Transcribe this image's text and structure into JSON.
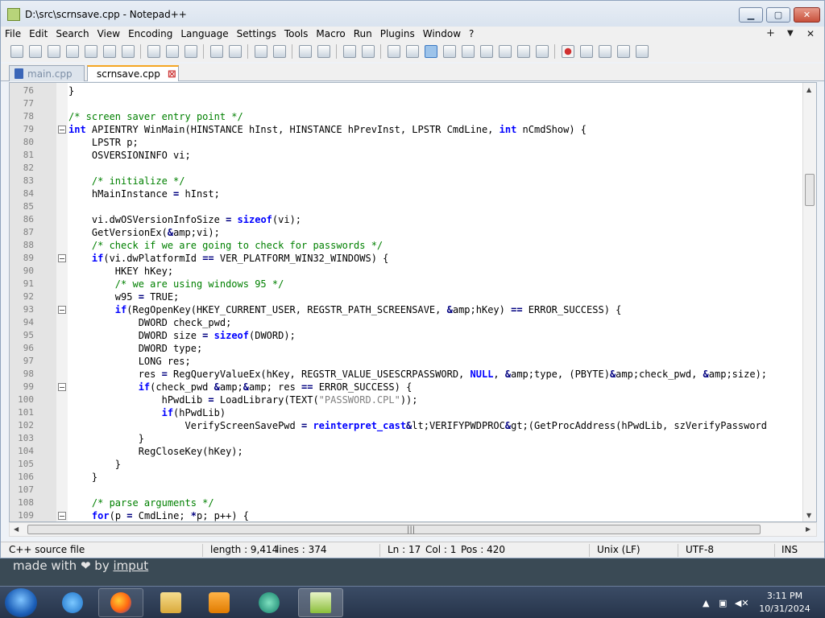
{
  "window": {
    "title": "D:\\src\\scrnsave.cpp - Notepad++"
  },
  "menu": [
    "File",
    "Edit",
    "Search",
    "View",
    "Encoding",
    "Language",
    "Settings",
    "Tools",
    "Macro",
    "Run",
    "Plugins",
    "Window",
    "?"
  ],
  "menu_right": {
    "plus": "+",
    "dropdown": "▼",
    "close": "✕"
  },
  "tabs": [
    {
      "label": "main.cpp",
      "active": false
    },
    {
      "label": "scrnsave.cpp",
      "active": true
    }
  ],
  "code_lines": [
    {
      "n": "76",
      "text": "}",
      "fold": false
    },
    {
      "n": "77",
      "text": "",
      "fold": false
    },
    {
      "n": "78",
      "text": "/* screen saver entry point */",
      "fold": false
    },
    {
      "n": "79",
      "text": "int APIENTRY WinMain(HINSTANCE hInst, HINSTANCE hPrevInst, LPSTR CmdLine, int nCmdShow) {",
      "fold": true
    },
    {
      "n": "80",
      "text": "    LPSTR p;",
      "fold": false
    },
    {
      "n": "81",
      "text": "    OSVERSIONINFO vi;",
      "fold": false
    },
    {
      "n": "82",
      "text": "",
      "fold": false
    },
    {
      "n": "83",
      "text": "    /* initialize */",
      "fold": false
    },
    {
      "n": "84",
      "text": "    hMainInstance = hInst;",
      "fold": false
    },
    {
      "n": "85",
      "text": "",
      "fold": false
    },
    {
      "n": "86",
      "text": "    vi.dwOSVersionInfoSize = sizeof(vi);",
      "fold": false
    },
    {
      "n": "87",
      "text": "    GetVersionEx(&vi);",
      "fold": false
    },
    {
      "n": "88",
      "text": "    /* check if we are going to check for passwords */",
      "fold": false
    },
    {
      "n": "89",
      "text": "    if(vi.dwPlatformId == VER_PLATFORM_WIN32_WINDOWS) {",
      "fold": true
    },
    {
      "n": "90",
      "text": "        HKEY hKey;",
      "fold": false
    },
    {
      "n": "91",
      "text": "        /* we are using windows 95 */",
      "fold": false
    },
    {
      "n": "92",
      "text": "        w95 = TRUE;",
      "fold": false
    },
    {
      "n": "93",
      "text": "        if(RegOpenKey(HKEY_CURRENT_USER, REGSTR_PATH_SCREENSAVE, &hKey) == ERROR_SUCCESS) {",
      "fold": true
    },
    {
      "n": "94",
      "text": "            DWORD check_pwd;",
      "fold": false
    },
    {
      "n": "95",
      "text": "            DWORD size = sizeof(DWORD);",
      "fold": false
    },
    {
      "n": "96",
      "text": "            DWORD type;",
      "fold": false
    },
    {
      "n": "97",
      "text": "            LONG res;",
      "fold": false
    },
    {
      "n": "98",
      "text": "            res = RegQueryValueEx(hKey, REGSTR_VALUE_USESCRPASSWORD, NULL, &type, (PBYTE)&check_pwd, &size);",
      "fold": false
    },
    {
      "n": "99",
      "text": "            if(check_pwd && res == ERROR_SUCCESS) {",
      "fold": true
    },
    {
      "n": "100",
      "text": "                hPwdLib = LoadLibrary(TEXT(\"PASSWORD.CPL\"));",
      "fold": false
    },
    {
      "n": "101",
      "text": "                if(hPwdLib)",
      "fold": false
    },
    {
      "n": "102",
      "text": "                    VerifyScreenSavePwd = reinterpret_cast<VERIFYPWDPROC>(GetProcAddress(hPwdLib, szVerifyPassword",
      "fold": false
    },
    {
      "n": "103",
      "text": "            }",
      "fold": false
    },
    {
      "n": "104",
      "text": "            RegCloseKey(hKey);",
      "fold": false
    },
    {
      "n": "105",
      "text": "        }",
      "fold": false
    },
    {
      "n": "106",
      "text": "    }",
      "fold": false
    },
    {
      "n": "107",
      "text": "",
      "fold": false
    },
    {
      "n": "108",
      "text": "    /* parse arguments */",
      "fold": false
    },
    {
      "n": "109",
      "text": "    for(p = CmdLine; *p; p++) {",
      "fold": true
    }
  ],
  "status": {
    "file_type": "C++ source file",
    "length": "length : 9,414",
    "lines": "lines : 374",
    "ln": "Ln : 17",
    "col": "Col : 1",
    "pos": "Pos : 420",
    "eol": "Unix (LF)",
    "encoding": "UTF-8",
    "mode": "INS"
  },
  "background_caption": {
    "prefix": "made with",
    "heart": "❤",
    "by": "by",
    "link": "imput"
  },
  "taskbar": {
    "apps": [
      "internet-explorer",
      "firefox",
      "file-explorer",
      "media-player",
      "media-center",
      "notepad-plus-plus"
    ],
    "clock_time": "3:11 PM",
    "clock_date": "10/31/2024"
  },
  "colors": {
    "keyword": "#0000ff",
    "comment": "#008000",
    "string": "#808080",
    "accent": "#f5a623"
  }
}
